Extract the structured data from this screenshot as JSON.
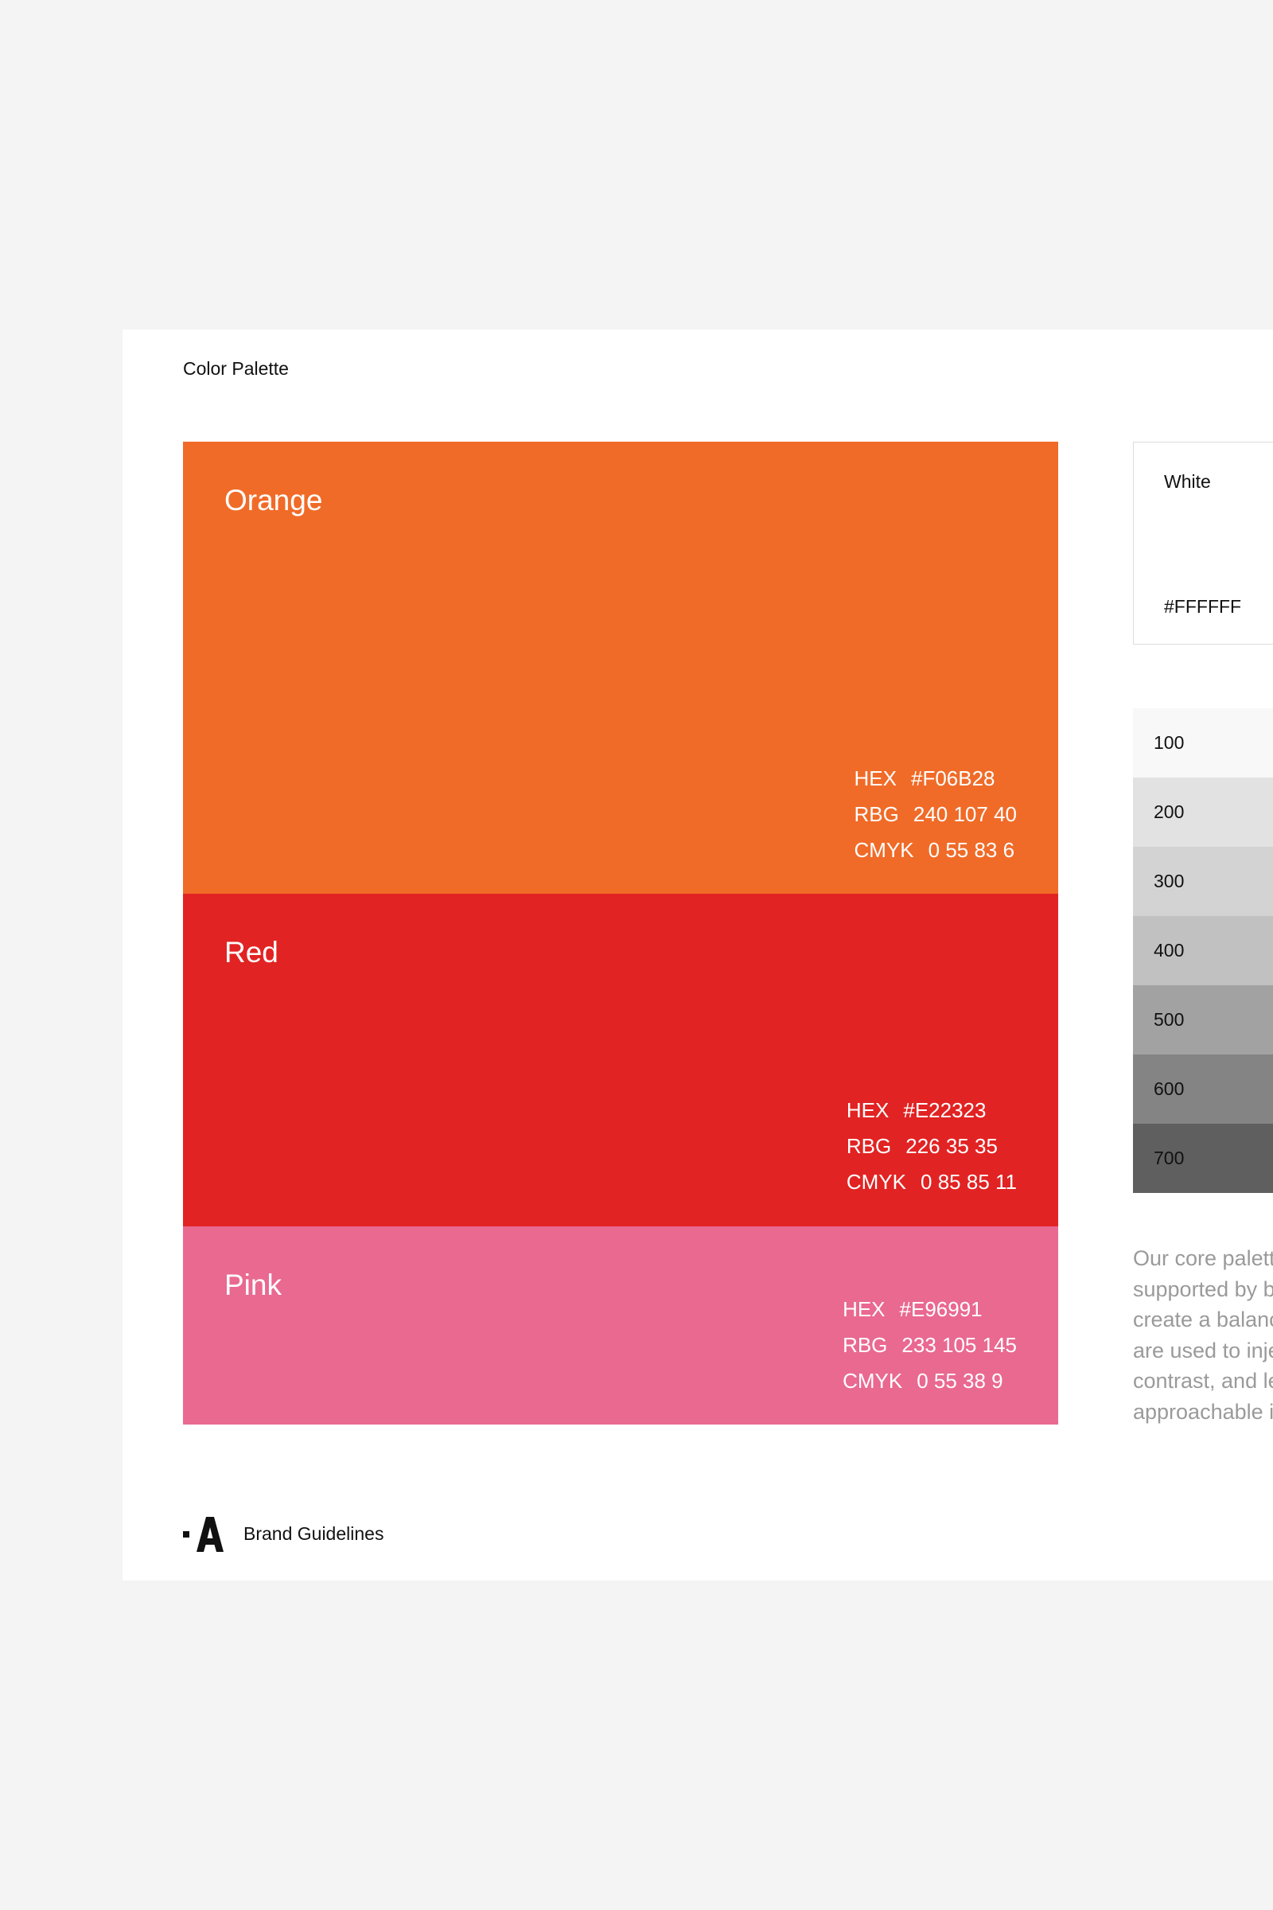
{
  "page": {
    "section_title": "Color Palette"
  },
  "swatches": [
    {
      "name": "Orange",
      "color": "#F06B28",
      "specs": [
        {
          "label": "HEX",
          "value": "#F06B28"
        },
        {
          "label": "RBG",
          "value": "240 107 40"
        },
        {
          "label": "CMYK",
          "value": "0 55 83 6"
        }
      ]
    },
    {
      "name": "Red",
      "color": "#E22323",
      "specs": [
        {
          "label": "HEX",
          "value": "#E22323"
        },
        {
          "label": "RBG",
          "value": "226 35 35"
        },
        {
          "label": "CMYK",
          "value": "0 85 85 11"
        }
      ]
    },
    {
      "name": "Pink",
      "color": "#E96991",
      "specs": [
        {
          "label": "HEX",
          "value": "#E96991"
        },
        {
          "label": "RBG",
          "value": "233 105 145"
        },
        {
          "label": "CMYK",
          "value": "0 55 38 9"
        }
      ]
    }
  ],
  "white_card": {
    "name": "White",
    "hex": "#FFFFFF"
  },
  "grays": [
    {
      "label": "100",
      "color": "#F8F8F8"
    },
    {
      "label": "200",
      "color": "#E2E2E2"
    },
    {
      "label": "300",
      "color": "#D3D3D3"
    },
    {
      "label": "400",
      "color": "#C1C1C1"
    },
    {
      "label": "500",
      "color": "#A2A2A2"
    },
    {
      "label": "600",
      "color": "#848484"
    },
    {
      "label": "700",
      "color": "#5F5F5F"
    }
  ],
  "description_lines": [
    "Our core palett",
    "supported by b",
    "create a balanc",
    "are used to inje",
    "contrast, and le",
    "approachable i"
  ],
  "footer": {
    "logo_letter": "A",
    "text": "Brand Guidelines"
  }
}
